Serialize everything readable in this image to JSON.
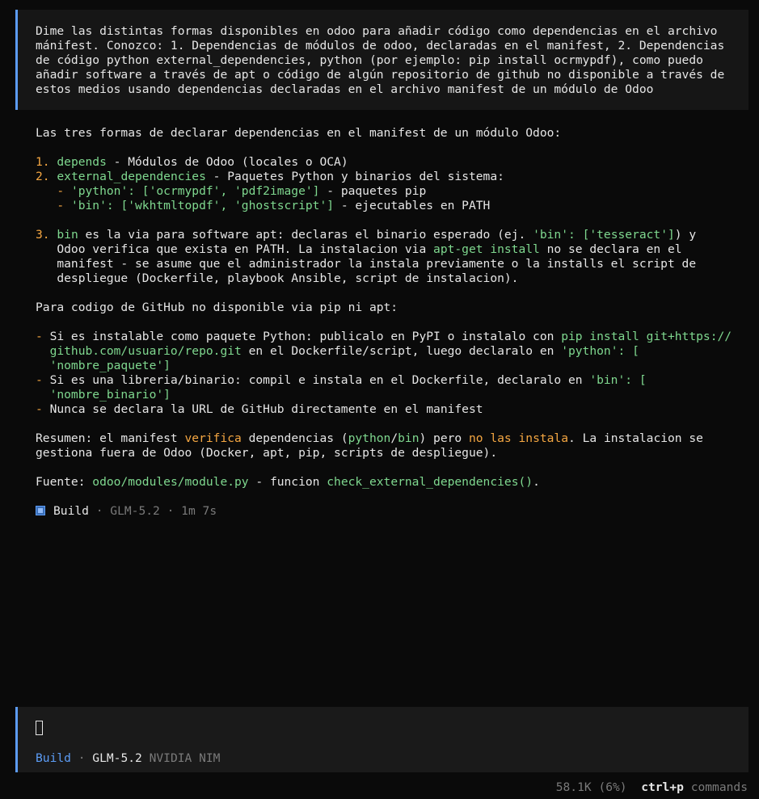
{
  "user_message": {
    "lines": [
      "Dime las distintas formas disponibles en odoo para añadir código como dependencias en el archivo",
      "mánifest. Conozco: 1. Dependencias de módulos de odoo, declaradas en el manifest, 2. Dependencias",
      "de código python external_dependencies, python (por ejemplo: pip install ocrmypdf), como puedo",
      "añadir software a través de apt o código de algún repositorio de github no disponible a través de",
      "estos medios usando dependencias declaradas en el archivo manifest de un módulo de Odoo"
    ]
  },
  "reply": {
    "intro": "Las tres formas de declarar dependencias en el manifest de un módulo Odoo:",
    "item1": {
      "num": "1.",
      "key": "depends",
      "rest": " - Módulos de Odoo (locales o OCA)"
    },
    "item2": {
      "num": "2.",
      "key": "external_dependencies",
      "rest": " - Paquetes Python y binarios del sistema:"
    },
    "item2_sub1": {
      "dash": "   - ",
      "code": "'python': ['ocrmypdf', 'pdf2image']",
      "rest": " - paquetes pip"
    },
    "item2_sub2": {
      "dash": "   - ",
      "code": "'bin': ['wkhtmltopdf', 'ghostscript']",
      "rest": " - ejecutables en PATH"
    },
    "item3": {
      "num": "3.",
      "key": "bin",
      "l1a": " es la via para software apt: declaras el binario esperado (ej. ",
      "l1code": "'bin': ['tesseract']",
      "l1b": ") y",
      "l2a": "   Odoo verifica que exista en PATH. La instalacion via ",
      "l2code": "apt-get install",
      "l2b": " no se declara en el",
      "l3": "   manifest - se asume que el administrador la instala previamente o la installs el script de",
      "l4": "   despliegue (Dockerfile, playbook Ansible, script de instalacion)."
    },
    "github_intro": "Para codigo de GitHub no disponible via pip ni apt:",
    "gh1": {
      "dash": "- ",
      "l1a": "Si es instalable como paquete Python: publicalo en PyPI o instalalo con ",
      "l1code": "pip install git+https://",
      "l2code": "  github.com/usuario/repo.git",
      "l2a": " en el Dockerfile/script, luego declaralo en ",
      "l2code2": "'python': [",
      "l3code": "  'nombre_paquete']"
    },
    "gh2": {
      "dash": "- ",
      "l1a": "Si es una libreria/binario: compil e instala en el Dockerfile, declaralo en ",
      "l1code": "'bin': [",
      "l2code": "  'nombre_binario']"
    },
    "gh3": {
      "dash": "- ",
      "text": "Nunca se declara la URL de GitHub directamente en el manifest"
    },
    "summary": {
      "l1a": "Resumen: el manifest ",
      "verifica": "verifica",
      "l1b": " dependencias (",
      "python": "python",
      "slash": "/",
      "bin": "bin",
      "l1c": ") pero ",
      "no_instala": "no las instala",
      "l1d": ". La instalacion se",
      "l2": "gestiona fuera de Odoo (Docker, apt, pip, scripts de despliegue)."
    },
    "source": {
      "label": "Fuente: ",
      "path": "odoo/modules/module.py",
      "mid": " - funcion ",
      "func": "check_external_dependencies()",
      "end": "."
    }
  },
  "build_status": {
    "label": "Build",
    "sep1": " · ",
    "model": "GLM-5.2",
    "sep2": " · ",
    "time": "1m 7s"
  },
  "input": {
    "mode": "Build",
    "sep": " · ",
    "model": "GLM-5.2",
    "provider": "NVIDIA NIM"
  },
  "status_bar": {
    "tokens": "58.1K (6%)",
    "shortcut": "ctrl+p",
    "shortcut_label": "commands"
  },
  "colors": {
    "accent": "#5c9cf5",
    "code": "#7fd88f",
    "number": "#f5a742",
    "muted": "#7a7a7a"
  }
}
